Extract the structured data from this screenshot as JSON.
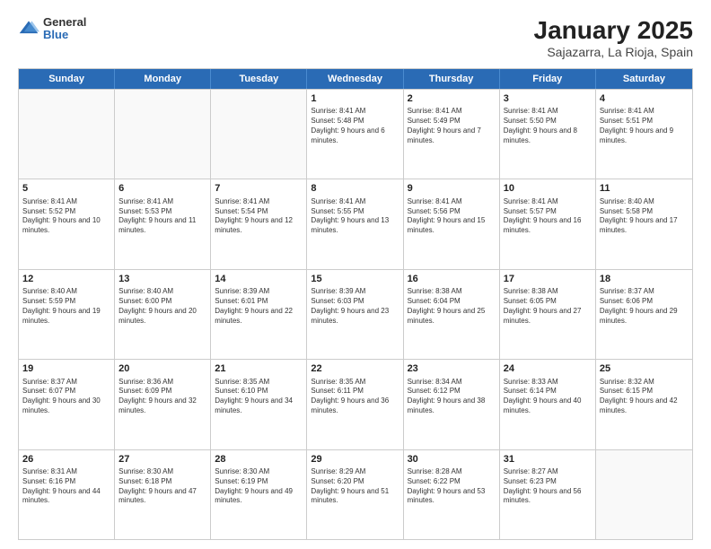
{
  "header": {
    "logo_general": "General",
    "logo_blue": "Blue",
    "main_title": "January 2025",
    "subtitle": "Sajazarra, La Rioja, Spain"
  },
  "days_of_week": [
    "Sunday",
    "Monday",
    "Tuesday",
    "Wednesday",
    "Thursday",
    "Friday",
    "Saturday"
  ],
  "weeks": [
    [
      {
        "day": "",
        "info": "",
        "empty": true
      },
      {
        "day": "",
        "info": "",
        "empty": true
      },
      {
        "day": "",
        "info": "",
        "empty": true
      },
      {
        "day": "1",
        "info": "Sunrise: 8:41 AM\nSunset: 5:48 PM\nDaylight: 9 hours and 6 minutes."
      },
      {
        "day": "2",
        "info": "Sunrise: 8:41 AM\nSunset: 5:49 PM\nDaylight: 9 hours and 7 minutes."
      },
      {
        "day": "3",
        "info": "Sunrise: 8:41 AM\nSunset: 5:50 PM\nDaylight: 9 hours and 8 minutes."
      },
      {
        "day": "4",
        "info": "Sunrise: 8:41 AM\nSunset: 5:51 PM\nDaylight: 9 hours and 9 minutes."
      }
    ],
    [
      {
        "day": "5",
        "info": "Sunrise: 8:41 AM\nSunset: 5:52 PM\nDaylight: 9 hours and 10 minutes."
      },
      {
        "day": "6",
        "info": "Sunrise: 8:41 AM\nSunset: 5:53 PM\nDaylight: 9 hours and 11 minutes."
      },
      {
        "day": "7",
        "info": "Sunrise: 8:41 AM\nSunset: 5:54 PM\nDaylight: 9 hours and 12 minutes."
      },
      {
        "day": "8",
        "info": "Sunrise: 8:41 AM\nSunset: 5:55 PM\nDaylight: 9 hours and 13 minutes."
      },
      {
        "day": "9",
        "info": "Sunrise: 8:41 AM\nSunset: 5:56 PM\nDaylight: 9 hours and 15 minutes."
      },
      {
        "day": "10",
        "info": "Sunrise: 8:41 AM\nSunset: 5:57 PM\nDaylight: 9 hours and 16 minutes."
      },
      {
        "day": "11",
        "info": "Sunrise: 8:40 AM\nSunset: 5:58 PM\nDaylight: 9 hours and 17 minutes."
      }
    ],
    [
      {
        "day": "12",
        "info": "Sunrise: 8:40 AM\nSunset: 5:59 PM\nDaylight: 9 hours and 19 minutes."
      },
      {
        "day": "13",
        "info": "Sunrise: 8:40 AM\nSunset: 6:00 PM\nDaylight: 9 hours and 20 minutes."
      },
      {
        "day": "14",
        "info": "Sunrise: 8:39 AM\nSunset: 6:01 PM\nDaylight: 9 hours and 22 minutes."
      },
      {
        "day": "15",
        "info": "Sunrise: 8:39 AM\nSunset: 6:03 PM\nDaylight: 9 hours and 23 minutes."
      },
      {
        "day": "16",
        "info": "Sunrise: 8:38 AM\nSunset: 6:04 PM\nDaylight: 9 hours and 25 minutes."
      },
      {
        "day": "17",
        "info": "Sunrise: 8:38 AM\nSunset: 6:05 PM\nDaylight: 9 hours and 27 minutes."
      },
      {
        "day": "18",
        "info": "Sunrise: 8:37 AM\nSunset: 6:06 PM\nDaylight: 9 hours and 29 minutes."
      }
    ],
    [
      {
        "day": "19",
        "info": "Sunrise: 8:37 AM\nSunset: 6:07 PM\nDaylight: 9 hours and 30 minutes."
      },
      {
        "day": "20",
        "info": "Sunrise: 8:36 AM\nSunset: 6:09 PM\nDaylight: 9 hours and 32 minutes."
      },
      {
        "day": "21",
        "info": "Sunrise: 8:35 AM\nSunset: 6:10 PM\nDaylight: 9 hours and 34 minutes."
      },
      {
        "day": "22",
        "info": "Sunrise: 8:35 AM\nSunset: 6:11 PM\nDaylight: 9 hours and 36 minutes."
      },
      {
        "day": "23",
        "info": "Sunrise: 8:34 AM\nSunset: 6:12 PM\nDaylight: 9 hours and 38 minutes."
      },
      {
        "day": "24",
        "info": "Sunrise: 8:33 AM\nSunset: 6:14 PM\nDaylight: 9 hours and 40 minutes."
      },
      {
        "day": "25",
        "info": "Sunrise: 8:32 AM\nSunset: 6:15 PM\nDaylight: 9 hours and 42 minutes."
      }
    ],
    [
      {
        "day": "26",
        "info": "Sunrise: 8:31 AM\nSunset: 6:16 PM\nDaylight: 9 hours and 44 minutes."
      },
      {
        "day": "27",
        "info": "Sunrise: 8:30 AM\nSunset: 6:18 PM\nDaylight: 9 hours and 47 minutes."
      },
      {
        "day": "28",
        "info": "Sunrise: 8:30 AM\nSunset: 6:19 PM\nDaylight: 9 hours and 49 minutes."
      },
      {
        "day": "29",
        "info": "Sunrise: 8:29 AM\nSunset: 6:20 PM\nDaylight: 9 hours and 51 minutes."
      },
      {
        "day": "30",
        "info": "Sunrise: 8:28 AM\nSunset: 6:22 PM\nDaylight: 9 hours and 53 minutes."
      },
      {
        "day": "31",
        "info": "Sunrise: 8:27 AM\nSunset: 6:23 PM\nDaylight: 9 hours and 56 minutes."
      },
      {
        "day": "",
        "info": "",
        "empty": true
      }
    ]
  ]
}
